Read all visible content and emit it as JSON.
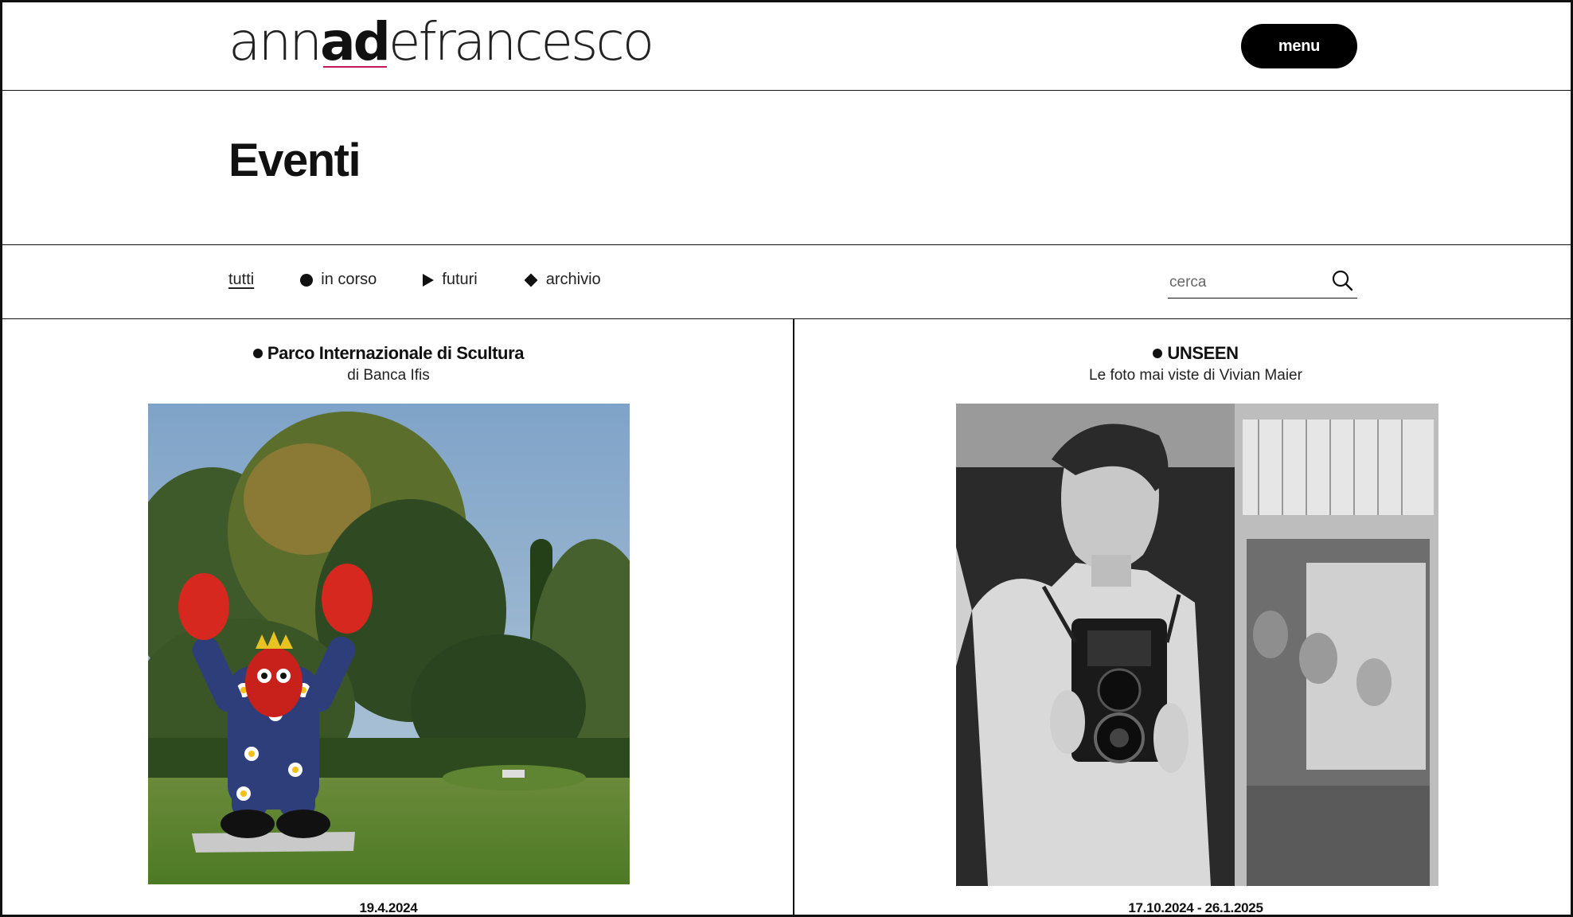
{
  "logo": {
    "part1": "ann",
    "part2": "ad",
    "part3": "efrancesco"
  },
  "header": {
    "menu_label": "menu"
  },
  "page": {
    "title": "Eventi"
  },
  "filters": [
    {
      "label": "tutti",
      "icon": "none",
      "active": true
    },
    {
      "label": "in corso",
      "icon": "circle-icon",
      "active": false
    },
    {
      "label": "futuri",
      "icon": "triangle-icon",
      "active": false
    },
    {
      "label": "archivio",
      "icon": "diamond-icon",
      "active": false
    }
  ],
  "search": {
    "placeholder": "cerca",
    "value": ""
  },
  "events": [
    {
      "status_icon": "circle-icon",
      "title": "Parco Internazionale di Scultura",
      "subtitle": "di Banca Ifis",
      "date": "19.4.2024",
      "image": "outdoor sculpture of red lobster figure with crown in a park"
    },
    {
      "status_icon": "circle-icon",
      "title": "UNSEEN",
      "subtitle": "Le foto mai viste di Vivian Maier",
      "date": "17.10.2024 - 26.1.2025",
      "image": "black and white self-portrait with twin-lens camera in mirrors"
    }
  ],
  "colors": {
    "accent": "#c2185b",
    "text": "#111111",
    "button_bg": "#000000"
  }
}
